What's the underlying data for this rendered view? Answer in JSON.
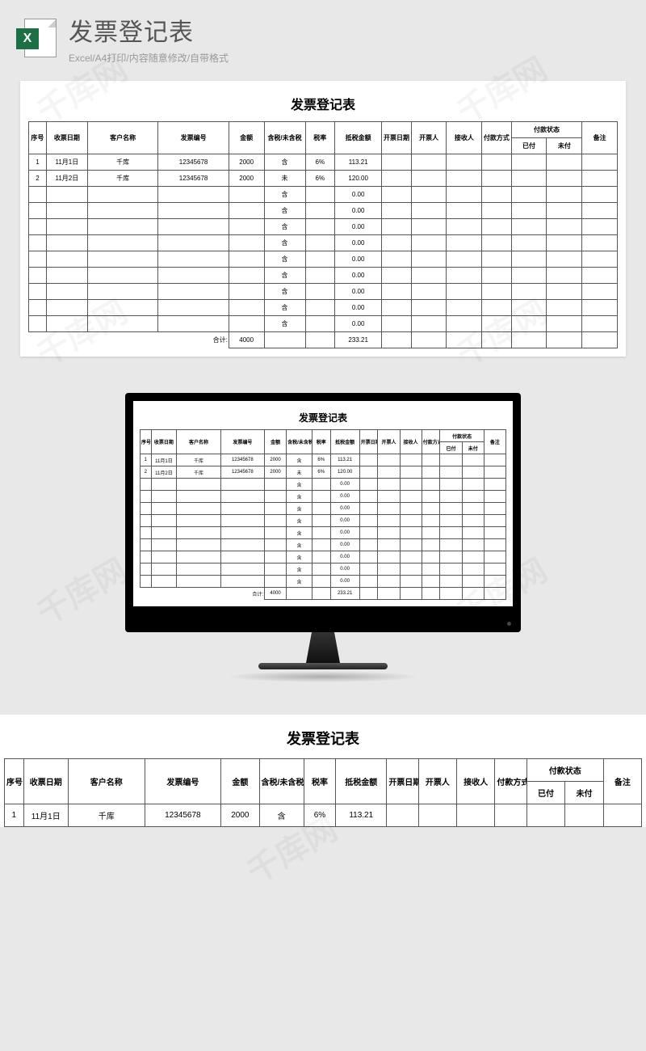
{
  "header": {
    "icon_letter": "X",
    "title": "发票登记表",
    "subtitle": "Excel/A4打印/内容随意修改/自带格式"
  },
  "watermark_text": "千库网",
  "table": {
    "title": "发票登记表",
    "headers": {
      "seq": "序号",
      "recv_date": "收票日期",
      "customer": "客户名称",
      "invoice_no": "发票编号",
      "amount": "金额",
      "tax_incl": "含税/未含税",
      "tax_rate": "税率",
      "tax_amount": "抵税金额",
      "issue_date": "开票日期",
      "issuer": "开票人",
      "receiver": "接收人",
      "pay_method": "付款方式",
      "pay_status": "付款状态",
      "paid": "已付",
      "unpaid": "未付",
      "note": "备注"
    },
    "rows": [
      {
        "seq": "1",
        "recv_date": "11月1日",
        "customer": "千库",
        "invoice_no": "12345678",
        "amount": "2000",
        "tax_incl": "含",
        "tax_rate": "6%",
        "tax_amount": "113.21",
        "issue_date": "",
        "issuer": "",
        "receiver": "",
        "pay_method": "",
        "paid": "",
        "unpaid": "",
        "note": ""
      },
      {
        "seq": "2",
        "recv_date": "11月2日",
        "customer": "千库",
        "invoice_no": "12345678",
        "amount": "2000",
        "tax_incl": "未",
        "tax_rate": "6%",
        "tax_amount": "120.00",
        "issue_date": "",
        "issuer": "",
        "receiver": "",
        "pay_method": "",
        "paid": "",
        "unpaid": "",
        "note": ""
      },
      {
        "seq": "",
        "recv_date": "",
        "customer": "",
        "invoice_no": "",
        "amount": "",
        "tax_incl": "含",
        "tax_rate": "",
        "tax_amount": "0.00",
        "issue_date": "",
        "issuer": "",
        "receiver": "",
        "pay_method": "",
        "paid": "",
        "unpaid": "",
        "note": ""
      },
      {
        "seq": "",
        "recv_date": "",
        "customer": "",
        "invoice_no": "",
        "amount": "",
        "tax_incl": "含",
        "tax_rate": "",
        "tax_amount": "0.00",
        "issue_date": "",
        "issuer": "",
        "receiver": "",
        "pay_method": "",
        "paid": "",
        "unpaid": "",
        "note": ""
      },
      {
        "seq": "",
        "recv_date": "",
        "customer": "",
        "invoice_no": "",
        "amount": "",
        "tax_incl": "含",
        "tax_rate": "",
        "tax_amount": "0.00",
        "issue_date": "",
        "issuer": "",
        "receiver": "",
        "pay_method": "",
        "paid": "",
        "unpaid": "",
        "note": ""
      },
      {
        "seq": "",
        "recv_date": "",
        "customer": "",
        "invoice_no": "",
        "amount": "",
        "tax_incl": "含",
        "tax_rate": "",
        "tax_amount": "0.00",
        "issue_date": "",
        "issuer": "",
        "receiver": "",
        "pay_method": "",
        "paid": "",
        "unpaid": "",
        "note": ""
      },
      {
        "seq": "",
        "recv_date": "",
        "customer": "",
        "invoice_no": "",
        "amount": "",
        "tax_incl": "含",
        "tax_rate": "",
        "tax_amount": "0.00",
        "issue_date": "",
        "issuer": "",
        "receiver": "",
        "pay_method": "",
        "paid": "",
        "unpaid": "",
        "note": ""
      },
      {
        "seq": "",
        "recv_date": "",
        "customer": "",
        "invoice_no": "",
        "amount": "",
        "tax_incl": "含",
        "tax_rate": "",
        "tax_amount": "0.00",
        "issue_date": "",
        "issuer": "",
        "receiver": "",
        "pay_method": "",
        "paid": "",
        "unpaid": "",
        "note": ""
      },
      {
        "seq": "",
        "recv_date": "",
        "customer": "",
        "invoice_no": "",
        "amount": "",
        "tax_incl": "含",
        "tax_rate": "",
        "tax_amount": "0.00",
        "issue_date": "",
        "issuer": "",
        "receiver": "",
        "pay_method": "",
        "paid": "",
        "unpaid": "",
        "note": ""
      },
      {
        "seq": "",
        "recv_date": "",
        "customer": "",
        "invoice_no": "",
        "amount": "",
        "tax_incl": "含",
        "tax_rate": "",
        "tax_amount": "0.00",
        "issue_date": "",
        "issuer": "",
        "receiver": "",
        "pay_method": "",
        "paid": "",
        "unpaid": "",
        "note": ""
      },
      {
        "seq": "",
        "recv_date": "",
        "customer": "",
        "invoice_no": "",
        "amount": "",
        "tax_incl": "含",
        "tax_rate": "",
        "tax_amount": "0.00",
        "issue_date": "",
        "issuer": "",
        "receiver": "",
        "pay_method": "",
        "paid": "",
        "unpaid": "",
        "note": ""
      }
    ],
    "total": {
      "label": "合计:",
      "amount": "4000",
      "tax_amount": "233.21"
    }
  }
}
